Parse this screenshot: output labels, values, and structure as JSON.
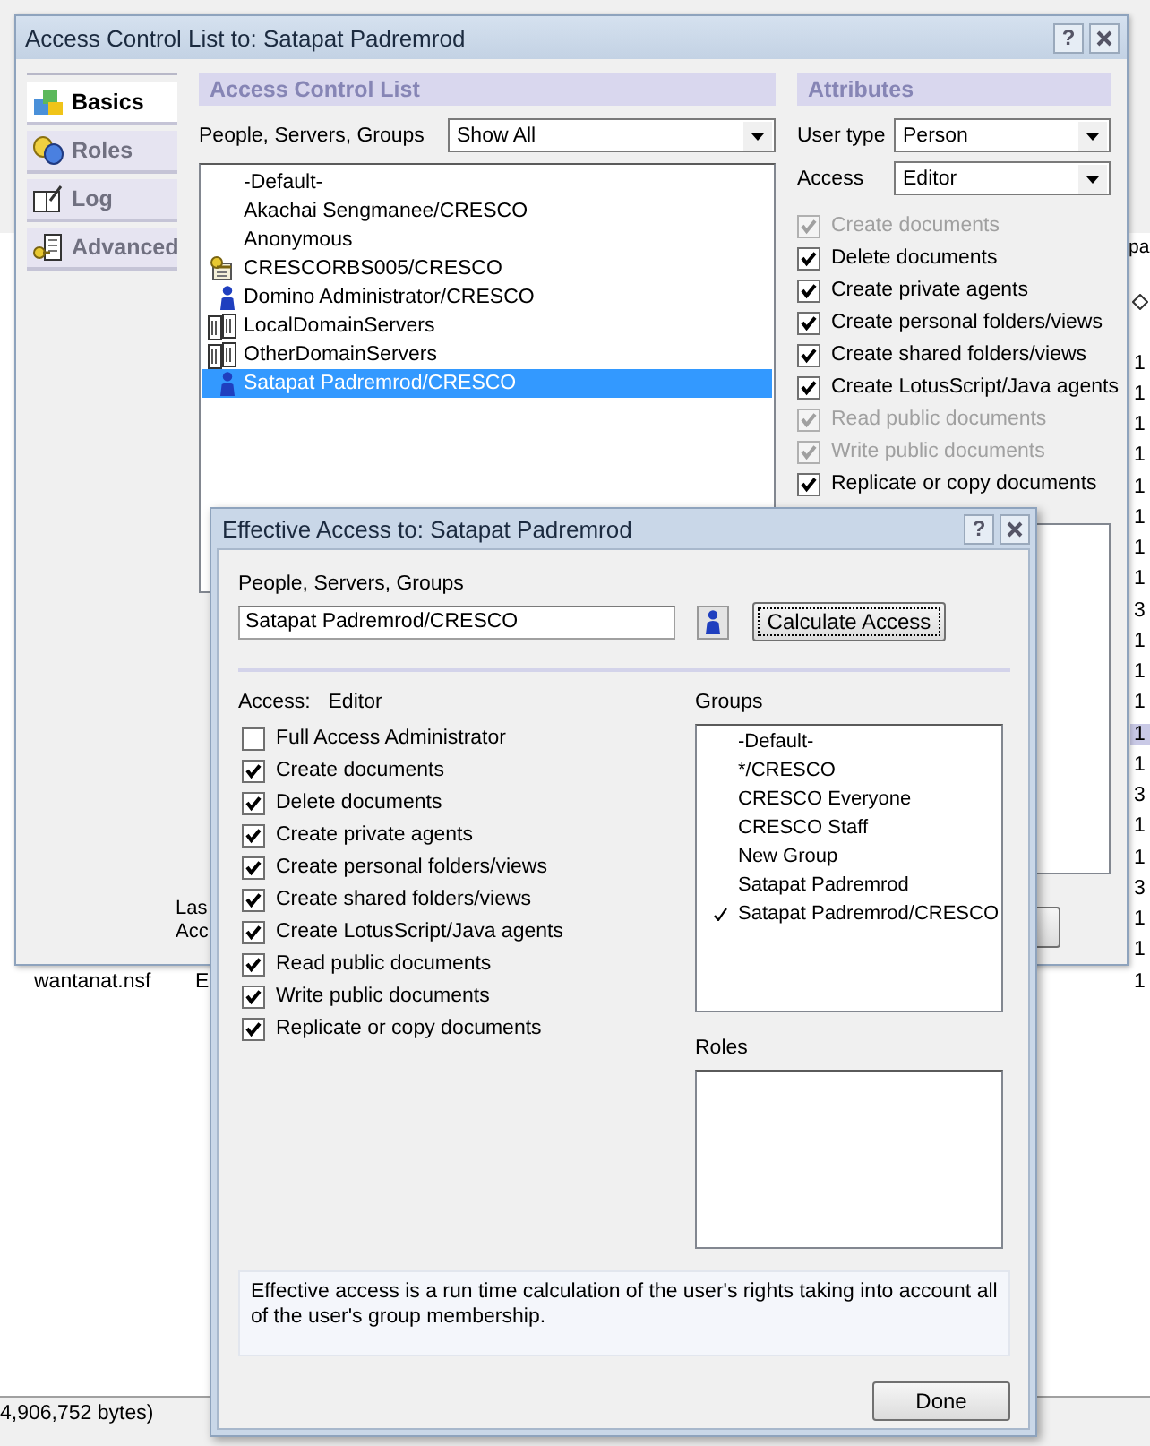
{
  "background_app": {
    "column_header": "pa",
    "rows": [
      {
        "column_3": "1",
        "selected": false
      },
      {
        "column_3": "1",
        "selected": false
      },
      {
        "column_3": "1",
        "selected": false
      },
      {
        "column_3": "1",
        "selected": false
      },
      {
        "column_3": "1",
        "selected": false
      },
      {
        "column_3": "1",
        "selected": false
      },
      {
        "column_3": "1",
        "selected": false
      },
      {
        "column_3": "1",
        "selected": false
      },
      {
        "column_3": "3",
        "selected": false
      },
      {
        "column_3": "1",
        "selected": false
      },
      {
        "column_3": "1",
        "selected": false
      },
      {
        "column_3": "1",
        "selected": false
      },
      {
        "column_3": "1",
        "selected": true
      },
      {
        "column_3": "1",
        "selected": false
      },
      {
        "column_3": "3",
        "selected": false
      },
      {
        "column_3": "1",
        "selected": false
      },
      {
        "column_3": "1",
        "selected": false
      },
      {
        "column_3": "3",
        "selected": false
      },
      {
        "column_3": "1",
        "selected": false
      },
      {
        "column_3": "1",
        "selected": false
      },
      {
        "column_1": "wantanat.nsf",
        "column_2": "E",
        "column_3": "1",
        "selected": false
      }
    ],
    "status_bar": "4,906,752 bytes)"
  },
  "acl_window": {
    "title": "Access Control List to: Satapat Padremrod",
    "help_button": "?",
    "tabs": [
      {
        "label": "Basics",
        "selected": true
      },
      {
        "label": "Roles",
        "selected": false
      },
      {
        "label": "Log",
        "selected": false
      },
      {
        "label": "Advanced",
        "selected": false
      }
    ],
    "acl_section": {
      "header": "Access Control List",
      "filter_label": "People, Servers, Groups",
      "filter_value": "Show All",
      "entries": [
        {
          "name": "-Default-",
          "kind": "plain",
          "selected": false
        },
        {
          "name": "Akachai Sengmanee/CRESCO",
          "kind": "plain",
          "selected": false
        },
        {
          "name": "Anonymous",
          "kind": "plain",
          "selected": false
        },
        {
          "name": "CRESCORBS005/CRESCO",
          "kind": "server",
          "selected": false
        },
        {
          "name": "Domino Administrator/CRESCO",
          "kind": "person",
          "selected": false
        },
        {
          "name": "LocalDomainServers",
          "kind": "group",
          "selected": false
        },
        {
          "name": "OtherDomainServers",
          "kind": "group",
          "selected": false
        },
        {
          "name": "Satapat Padremrod/CRESCO",
          "kind": "person",
          "selected": true
        }
      ]
    },
    "attributes": {
      "header": "Attributes",
      "user_type_label": "User type",
      "user_type": "Person",
      "access_label": "Access",
      "access": "Editor",
      "permissions": [
        {
          "label": "Create documents",
          "checked": true,
          "disabled": true
        },
        {
          "label": "Delete documents",
          "checked": true,
          "disabled": false
        },
        {
          "label": "Create private agents",
          "checked": true,
          "disabled": false
        },
        {
          "label": "Create personal folders/views",
          "checked": true,
          "disabled": false
        },
        {
          "label": "Create shared folders/views",
          "checked": true,
          "disabled": false
        },
        {
          "label": "Create LotusScript/Java agents",
          "checked": true,
          "disabled": false
        },
        {
          "label": "Read public documents",
          "checked": true,
          "disabled": true
        },
        {
          "label": "Write public documents",
          "checked": true,
          "disabled": true
        },
        {
          "label": "Replicate or copy documents",
          "checked": true,
          "disabled": false
        }
      ]
    },
    "footer_lines": [
      "Las",
      "Acc"
    ]
  },
  "effective_access_dialog": {
    "title": "Effective Access to: Satapat Padremrod",
    "help_button": "?",
    "people_label": "People, Servers, Groups",
    "people_value": "Satapat Padremrod/CRESCO",
    "calculate_button": "Calculate Access",
    "access_label": "Access:",
    "access_value": "Editor",
    "permissions": [
      {
        "label": "Full Access Administrator",
        "checked": false
      },
      {
        "label": "Create documents",
        "checked": true
      },
      {
        "label": "Delete documents",
        "checked": true
      },
      {
        "label": "Create private agents",
        "checked": true
      },
      {
        "label": "Create personal folders/views",
        "checked": true
      },
      {
        "label": "Create shared folders/views",
        "checked": true
      },
      {
        "label": "Create LotusScript/Java agents",
        "checked": true
      },
      {
        "label": "Read public documents",
        "checked": true
      },
      {
        "label": "Write public documents",
        "checked": true
      },
      {
        "label": "Replicate or copy documents",
        "checked": true
      }
    ],
    "groups_label": "Groups",
    "groups": [
      {
        "name": "-Default-",
        "checked": false
      },
      {
        "name": "*/CRESCO",
        "checked": false
      },
      {
        "name": "CRESCO Everyone",
        "checked": false
      },
      {
        "name": "CRESCO Staff",
        "checked": false
      },
      {
        "name": "New Group",
        "checked": false
      },
      {
        "name": "Satapat Padremrod",
        "checked": false
      },
      {
        "name": "Satapat Padremrod/CRESCO",
        "checked": true
      }
    ],
    "roles_label": "Roles",
    "note": "Effective access is a run time calculation of the user's rights taking into account all of the user's group membership.",
    "done_button": "Done"
  }
}
